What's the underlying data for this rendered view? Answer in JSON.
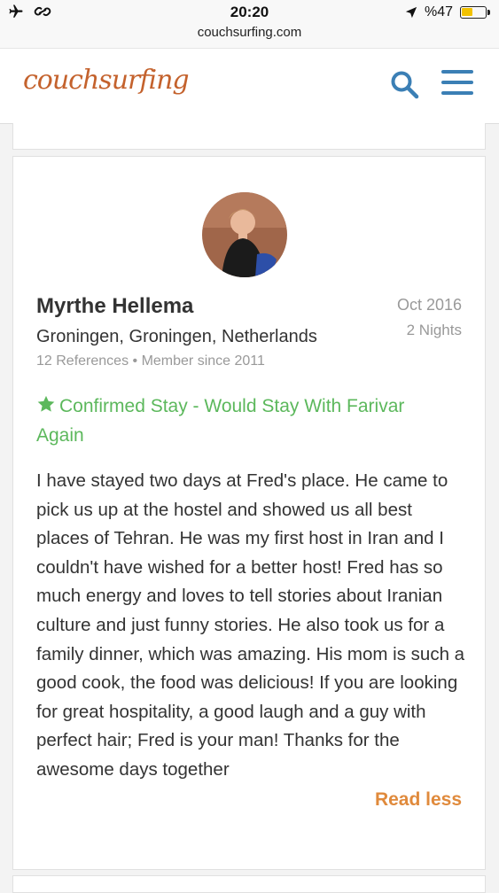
{
  "status_bar": {
    "time": "20:20",
    "battery": "%47",
    "battery_level": 0.47
  },
  "browser": {
    "url": "couchsurfing.com"
  },
  "header": {
    "logo": "couchsurfing"
  },
  "reference": {
    "name": "Myrthe Hellema",
    "location": "Groningen, Groningen, Netherlands",
    "references": "12 References",
    "member_since": "Member since 2011",
    "date": "Oct 2016",
    "nights": "2 Nights",
    "status": "Confirmed Stay - Would Stay With Farivar Again",
    "text": "I have stayed two days at Fred's place. He came to pick us up at the hostel and showed us all best places of Tehran. He was my first host in Iran and I couldn't have wished for a better host! Fred has so much energy and loves to tell stories about Iranian culture and just funny stories. He also took us for a family dinner, which was amazing. His mom is such a good cook, the food was delicious! If you are looking for great hospitality, a good laugh and a guy with perfect hair; Fred is your man! Thanks for the awesome days together",
    "read_less": "Read less"
  },
  "colors": {
    "brand": "#c4622d",
    "accent": "#3b7fb5",
    "confirmed": "#5cb85c",
    "link": "#e08a3c",
    "muted": "#999999"
  }
}
